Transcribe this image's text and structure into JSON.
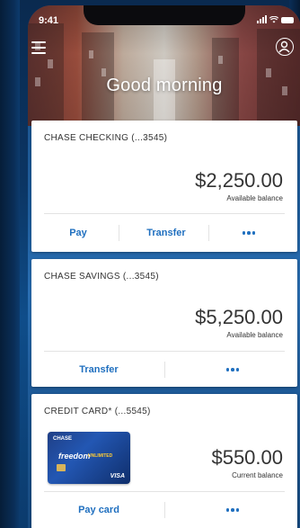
{
  "status_bar": {
    "time": "9:41"
  },
  "header": {
    "greeting": "Good morning"
  },
  "accounts": [
    {
      "title": "CHASE CHECKING (...3545)",
      "amount": "$2,250.00",
      "sublabel": "Available balance",
      "actions": [
        "Pay",
        "Transfer"
      ]
    },
    {
      "title": "CHASE SAVINGS (...3545)",
      "amount": "$5,250.00",
      "sublabel": "Available balance",
      "actions": [
        "Transfer"
      ]
    },
    {
      "title": "CREDIT CARD* (...5545)",
      "amount": "$550.00",
      "sublabel": "Current balance",
      "actions": [
        "Pay card"
      ],
      "card_art": {
        "issuer": "CHASE",
        "product": "freedom",
        "product_sub": "UNLIMITED",
        "network": "VISA"
      }
    }
  ],
  "icons": [
    "menu-icon",
    "profile-icon",
    "more-icon",
    "signal-icon",
    "wifi-icon",
    "battery-icon"
  ],
  "colors": {
    "accent": "#1f6fbf",
    "background": "#0b3563"
  }
}
